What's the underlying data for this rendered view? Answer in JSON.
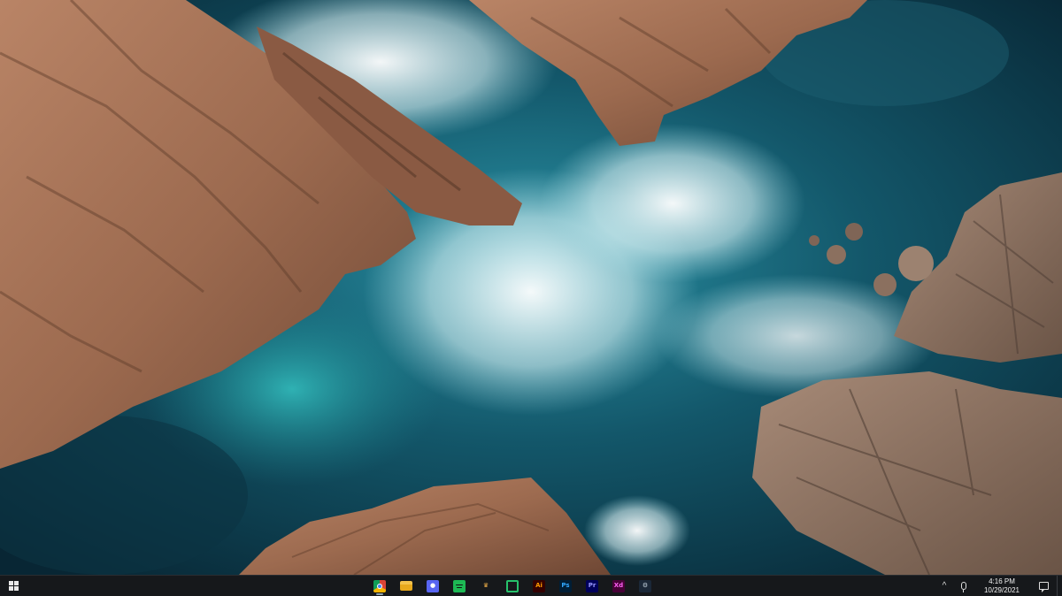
{
  "desktop": {
    "wallpaper": "aerial-coastline-rocks-and-waves"
  },
  "taskbar": {
    "start_icon": "windows-logo-icon",
    "apps": [
      {
        "id": "chrome",
        "icon": "chrome-icon",
        "running": true
      },
      {
        "id": "file-explorer",
        "icon": "folder-icon",
        "running": false
      },
      {
        "id": "discord",
        "icon": "discord-icon",
        "running": false
      },
      {
        "id": "spotify",
        "icon": "spotify-icon",
        "running": false
      },
      {
        "id": "lamp",
        "icon": "lamp-icon",
        "running": false
      },
      {
        "id": "ring-app",
        "icon": "ring-icon",
        "running": false
      },
      {
        "id": "illustrator",
        "icon": "illustrator-icon",
        "label": "Ai",
        "running": false
      },
      {
        "id": "photoshop",
        "icon": "photoshop-icon",
        "label": "Ps",
        "running": false
      },
      {
        "id": "premiere",
        "icon": "premiere-icon",
        "label": "Pr",
        "running": false
      },
      {
        "id": "xd",
        "icon": "xd-icon",
        "label": "Xd",
        "running": false
      },
      {
        "id": "steam",
        "icon": "steam-icon",
        "running": false
      }
    ],
    "tray": {
      "chevron": "^",
      "mic_icon": "microphone-icon",
      "time": "4:16 PM",
      "date": "10/29/2021",
      "notification_icon": "notification-icon"
    }
  },
  "colors": {
    "taskbar_bg": "#16181b",
    "water_deep": "#0c2d3a",
    "water_turquoise": "#1f8d9a",
    "rock": "#a06d52"
  }
}
